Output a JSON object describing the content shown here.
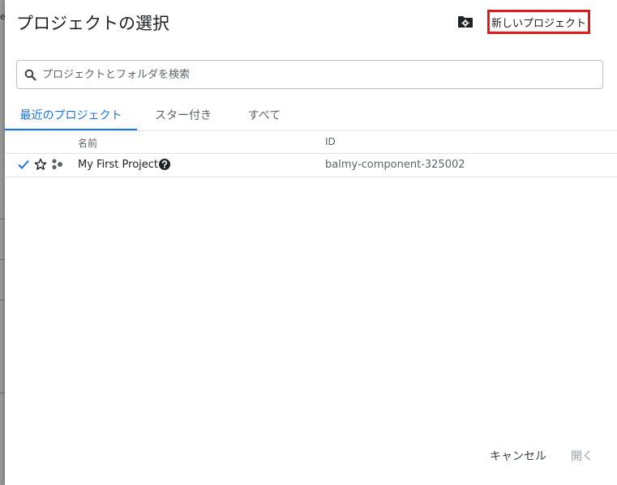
{
  "background": {
    "glyph": "e"
  },
  "dialog": {
    "title": "プロジェクトの選択",
    "org_icon": "folder-gear-icon",
    "new_project_label": "新しいプロジェクト",
    "search": {
      "placeholder": "プロジェクトとフォルダを検索",
      "value": ""
    },
    "tabs": [
      {
        "label": "最近のプロジェクト",
        "active": true
      },
      {
        "label": "スター付き",
        "active": false
      },
      {
        "label": "すべて",
        "active": false
      }
    ],
    "table": {
      "columns": [
        "名前",
        "ID"
      ],
      "rows": [
        {
          "name": "My First Project",
          "id": "balmy-component-325002",
          "selected": true,
          "starred": false
        }
      ]
    },
    "footer": {
      "cancel_label": "キャンセル",
      "open_label": "開く"
    }
  },
  "colors": {
    "accent": "#1a73e8",
    "highlight": "#e01919"
  }
}
